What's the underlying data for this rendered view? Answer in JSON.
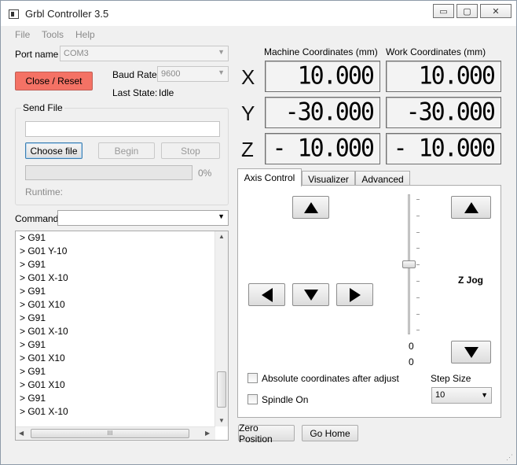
{
  "window": {
    "title": "Grbl Controller 3.5",
    "buttons": {
      "minimize": "▭",
      "maximize": "▢",
      "close": "✕"
    }
  },
  "menu": {
    "file": "File",
    "tools": "Tools",
    "help": "Help"
  },
  "connection": {
    "port_label": "Port name",
    "port_value": "COM3",
    "baud_label": "Baud Rate",
    "baud_value": "9600",
    "close_reset_label": "Close / Reset",
    "last_state_label": "Last State:",
    "last_state_value": "Idle"
  },
  "send_file": {
    "group_label": "Send File",
    "file_path": "",
    "choose_label": "Choose file",
    "begin_label": "Begin",
    "stop_label": "Stop",
    "progress_percent": 0,
    "progress_text": "0%",
    "runtime_label": "Runtime:"
  },
  "command": {
    "label": "Command",
    "value": ""
  },
  "console": {
    "lines": [
      "> G91",
      "> G01 Y-10",
      "> G91",
      "> G01 X-10",
      "> G91",
      "> G01 X10",
      "> G91",
      "> G01 X-10",
      "> G91",
      "> G01 X10",
      "> G91",
      "> G01 X10",
      "> G91",
      "> G01 X-10"
    ],
    "scroll_grip": "III"
  },
  "coordinates": {
    "machine_label": "Machine Coordinates  (mm)",
    "work_label": "Work Coordinates  (mm)",
    "axes": [
      {
        "letter": "X",
        "machine": "10.000",
        "work": "10.000"
      },
      {
        "letter": "Y",
        "machine": "-30.000",
        "work": "-30.000"
      },
      {
        "letter": "Z",
        "machine": "- 10.000",
        "work": "- 10.000"
      }
    ]
  },
  "tabs": [
    {
      "label": "Axis Control",
      "selected": true
    },
    {
      "label": "Visualizer",
      "selected": false
    },
    {
      "label": "Advanced",
      "selected": false
    }
  ],
  "axis_control": {
    "z_jog_label": "Z Jog",
    "slider_value_top": "0",
    "slider_value_bottom": "0",
    "absolute_coords_label": "Absolute coordinates after adjust",
    "absolute_coords_checked": false,
    "spindle_label": "Spindle On",
    "spindle_checked": false,
    "step_size_label": "Step Size",
    "step_size_value": "10"
  },
  "bottom_buttons": {
    "zero_position": "Zero Position",
    "go_home": "Go Home"
  },
  "colors": {
    "close_reset_bg": "#f47265",
    "window_bg": "#f0f0f0"
  }
}
